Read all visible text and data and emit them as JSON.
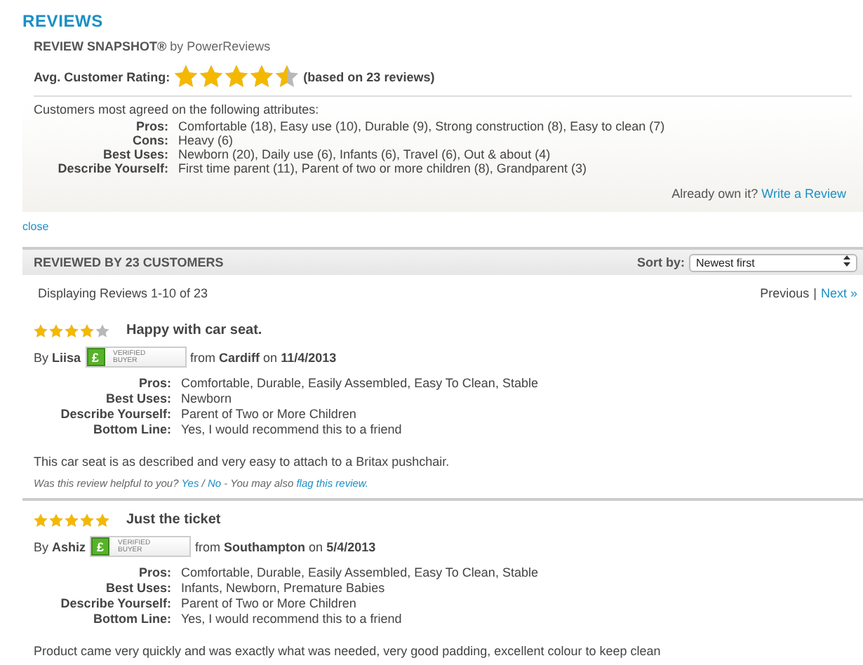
{
  "heading": "REVIEWS",
  "snapshot": {
    "title": "REVIEW SNAPSHOT®",
    "by": "by PowerReviews",
    "rating_label": "Avg. Customer Rating:",
    "stars": 4.5,
    "based_on": "(based on 23 reviews)",
    "intro": "Customers most agreed on the following attributes:",
    "attributes": [
      {
        "label": "Pros:",
        "value": "Comfortable (18), Easy use (10), Durable (9), Strong construction (8), Easy to clean (7)"
      },
      {
        "label": "Cons:",
        "value": "Heavy (6)"
      },
      {
        "label": "Best Uses:",
        "value": "Newborn (20), Daily use (6), Infants (6), Travel (6), Out & about (4)"
      },
      {
        "label": "Describe Yourself:",
        "value": "First time parent (11), Parent of two or more children (8), Grandparent (3)"
      }
    ],
    "own_prompt": "Already own it?",
    "write_link": "Write a Review"
  },
  "close_link": "close",
  "list_header": {
    "title": "REVIEWED BY 23 CUSTOMERS",
    "sort_label": "Sort by:",
    "sort_value": "Newest first"
  },
  "pagination": {
    "displaying": "Displaying Reviews 1-10 of 23",
    "previous": "Previous",
    "separator": "|",
    "next": "Next »"
  },
  "reviews": [
    {
      "stars": 4,
      "title": "Happy with car seat.",
      "by": "By",
      "author": "Liisa",
      "badge": {
        "symbol": "£",
        "line_1": "VERIFIED",
        "line_2": "BUYER"
      },
      "from": "from",
      "location": "Cardiff",
      "on": "on",
      "date": "11/4/2013",
      "attributes": [
        {
          "label": "Pros:",
          "value": "Comfortable, Durable, Easily Assembled, Easy To Clean, Stable"
        },
        {
          "label": "Best Uses:",
          "value": "Newborn"
        },
        {
          "label": "Describe Yourself:",
          "value": "Parent of Two or More Children"
        },
        {
          "label": "Bottom Line:",
          "value": "Yes, I would recommend this to a friend"
        }
      ],
      "body": "This car seat is as described and very easy to attach to a Britax pushchair.",
      "helpful": {
        "question": "Was this review helpful to you?",
        "yes": "Yes",
        "slash": "/",
        "no": "No",
        "also": "- You may also",
        "flag": "flag this review."
      }
    },
    {
      "stars": 5,
      "title": "Just the ticket",
      "by": "By",
      "author": "Ashiz",
      "badge": {
        "symbol": "£",
        "line_1": "VERIFIED",
        "line_2": "BUYER"
      },
      "from": "from",
      "location": "Southampton",
      "on": "on",
      "date": "5/4/2013",
      "attributes": [
        {
          "label": "Pros:",
          "value": "Comfortable, Durable, Easily Assembled, Easy To Clean, Stable"
        },
        {
          "label": "Best Uses:",
          "value": "Infants, Newborn, Premature Babies"
        },
        {
          "label": "Describe Yourself:",
          "value": "Parent of Two or More Children"
        },
        {
          "label": "Bottom Line:",
          "value": "Yes, I would recommend this to a friend"
        }
      ],
      "body": "Product came very quickly and was exactly what was needed, very good padding, excellent colour to keep clean"
    }
  ]
}
